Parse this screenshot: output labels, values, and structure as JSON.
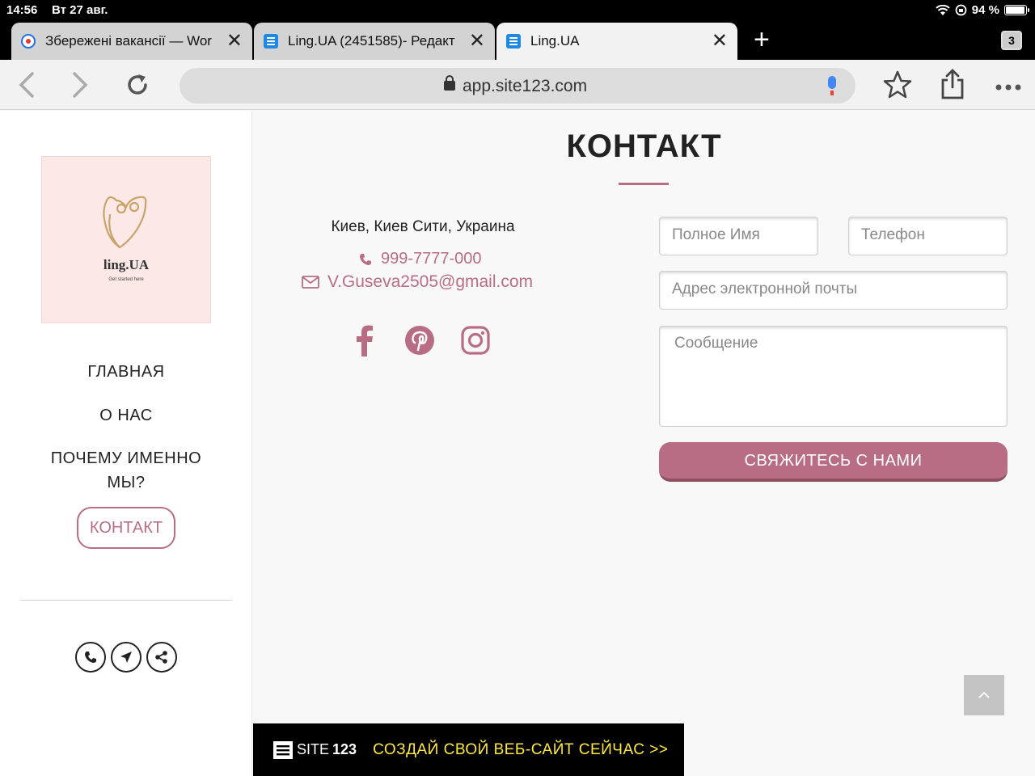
{
  "status_bar": {
    "time": "14:56",
    "date": "Вт 27 авг.",
    "battery": "94 %",
    "battery_level": 0.94
  },
  "browser": {
    "tabs": [
      {
        "title": "Збережені вакансії — Wor",
        "icon": "target-favicon-icon"
      },
      {
        "title": "Ling.UA (2451585)- Редакт",
        "icon": "site123-favicon-icon"
      },
      {
        "title": "Ling.UA",
        "icon": "site123-favicon-icon",
        "active": true
      }
    ],
    "tab_count": "3",
    "url": "app.site123.com"
  },
  "sidebar": {
    "logo": {
      "brand": "ling.UA",
      "tagline": "Get started here",
      "background": "#fde8e8"
    },
    "menu": [
      {
        "label": "ГЛАВНАЯ"
      },
      {
        "label": "О НАС"
      },
      {
        "label": "ПОЧЕМУ ИМЕННО"
      },
      {
        "label": "МЫ?"
      },
      {
        "label": "КОНТАКТ",
        "active": true
      }
    ]
  },
  "contact": {
    "title": "КОНТАКТ",
    "address": "Киев, Киев Сити, Украина",
    "phone": "999-7777-000",
    "email": "V.Guseva2505@gmail.com",
    "social": [
      "facebook-icon",
      "pinterest-icon",
      "instagram-icon"
    ],
    "form": {
      "name_placeholder": "Полное Имя",
      "phone_placeholder": "Телефон",
      "email_placeholder": "Адрес электронной почты",
      "message_placeholder": "Сообщение",
      "submit_label": "СВЯЖИТЕСЬ С НАМИ"
    }
  },
  "banner": {
    "brand_light": "SITE",
    "brand_bold": "123",
    "cta": "СОЗДАЙ СВОЙ ВЕБ-САЙТ СЕЙЧАС >>"
  },
  "colors": {
    "accent": "#b86d84",
    "banner_cta": "#ffe93b"
  }
}
